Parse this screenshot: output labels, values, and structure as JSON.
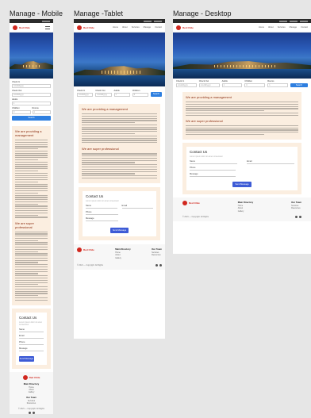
{
  "boards": {
    "mobile": "Manage - Mobile",
    "tablet": "Manage -Tablet",
    "desktop": "Manage - Desktop"
  },
  "nav": {
    "brand": "Red Chile",
    "links": [
      "Home",
      "About",
      "Services",
      "Manage",
      "Contact"
    ]
  },
  "booking": {
    "fields": [
      {
        "label": "Check In",
        "value": "mm/dd/yyyy"
      },
      {
        "label": "Check Out",
        "value": "mm/dd/yyyy"
      },
      {
        "label": "Adults",
        "value": "1"
      },
      {
        "label": "Children",
        "value": "0"
      },
      {
        "label": "Rooms",
        "value": "1"
      }
    ],
    "button": "Search"
  },
  "sections": {
    "management_title": "We are providing a management",
    "professional_title": "We are super professional"
  },
  "contact": {
    "title": "Contact Us",
    "subtitle": "Lorem ipsum dolor sit amet consectetur",
    "fields": [
      "Name",
      "Email",
      "Phone",
      "Message"
    ],
    "submit": "Send Message"
  },
  "footer": {
    "brand": "Red Chile",
    "col1_title": "Main Directory",
    "col1_items": [
      "Home",
      "About",
      "Gallery"
    ],
    "col2_title": "Our Team",
    "col2_items": [
      "Services",
      "Resources"
    ],
    "copyright": "© 2021 — Copyright. All Rights"
  },
  "colors": {
    "brand_red": "#d1281f",
    "card_bg": "#fbeee0",
    "button_blue": "#2e7fe0",
    "submit_blue": "#3d5bd6"
  }
}
